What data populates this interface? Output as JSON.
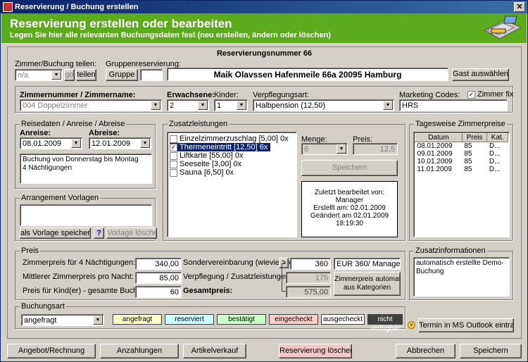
{
  "window": {
    "title": "Reservierung / Buchung erstellen",
    "close": "✕"
  },
  "header": {
    "title": "Reservierung erstellen oder bearbeiten",
    "subtitle": "Legen Sie hier alle relevanten Buchungsdaten fest (neu erstellen, ändern oder löschen)"
  },
  "reservation": {
    "number_label": "Reservierungsnummer 66"
  },
  "share": {
    "label": "Zimmer/Buchung teilen:",
    "value": "n/a",
    "go": "go",
    "teilen": "teilen"
  },
  "group": {
    "label": "Gruppenreservierung:",
    "button": "Gruppe",
    "value": ""
  },
  "guest": {
    "text": "Maik Olavssen  Hafenmeile 66a 20095 Hamburg",
    "select_button": "Gast auswählen"
  },
  "room": {
    "label": "Zimmernummer / Zimmername:",
    "value": "004 Doppelzimmer"
  },
  "adults": {
    "label": "Erwachsene:",
    "value": "2"
  },
  "kids": {
    "label": "Kinder:",
    "value": "1"
  },
  "meal": {
    "label": "Verpflegungsart:",
    "value": "Halbpension (12,50)"
  },
  "marketing": {
    "label": "Marketing Codes:",
    "fix_label": "Zimmer fix",
    "value": "HRS"
  },
  "travel": {
    "title": "Reisedaten / Anreise / Abreise",
    "arrival_label": "Anreise:",
    "arrival": "08.01.2009",
    "departure_label": "Abreise:",
    "departure": "12.01.2009",
    "info_line1": "Buchung von Donnerstag bis Montag",
    "info_line2": "4 Nächtigungen"
  },
  "arrangement": {
    "title": "Arrangement Vorlagen",
    "save": "als Vorlage speichern",
    "help": "?",
    "delete": "Vorlage löschen"
  },
  "extras": {
    "title": "Zusatzleistungen",
    "items": [
      {
        "label": "Einzelzimmerzuschlag  [5,00] 0x",
        "checked": false,
        "selected": false
      },
      {
        "label": "Thermeneintritt  [12,50] 6x",
        "checked": true,
        "selected": true
      },
      {
        "label": "Liftkarte  [55,00] 0x",
        "checked": false,
        "selected": false
      },
      {
        "label": "Seeseite  [3,00] 0x",
        "checked": false,
        "selected": false
      },
      {
        "label": "Sauna  [6,50] 0x",
        "checked": false,
        "selected": false
      }
    ],
    "qty_label": "Menge:",
    "qty": "6",
    "price_label": "Preis:",
    "price": "12,5",
    "save": "Speichern",
    "edit_info": [
      "Zuletzt bearbeitet von:",
      "Manager",
      "Erstellt am: 02.01.2009",
      "Geändert am 02.01.2009 18:19:30"
    ]
  },
  "daily": {
    "title": "Tagesweise Zimmerpreise",
    "columns": [
      "Datum",
      "Preis",
      "Kat."
    ],
    "rows": [
      [
        "08.01.2009",
        "85",
        "D..."
      ],
      [
        "09.01.2009",
        "85",
        "D..."
      ],
      [
        "10.01.2009",
        "85",
        "D..."
      ],
      [
        "11.01.2009",
        "85",
        "D..."
      ]
    ]
  },
  "price": {
    "title": "Preis",
    "room_label": "Zimmerpreis für 4 Nächtigungen:",
    "room": "340,00",
    "avg_label": "Mittlerer Zimmerpreis pro Nacht:",
    "avg": "85,00",
    "kids_label": "Preis für Kind(er) - gesamte Buchung:",
    "kids": "60",
    "special_label": "Sondervereinbarung (wieviel/wer):",
    "special_btn": ">",
    "special": "360",
    "special_who": "EUR 360/ Manager",
    "extras_label": "Verpflegung / Zusatzleistungen:",
    "extras": "175",
    "total_label": "Gesamtpreis:",
    "total": "575,00",
    "auto_btn_line1": "Zimmerpreis automatisch",
    "auto_btn_line2": "aus Kategorien"
  },
  "info": {
    "title": "Zusatzinformationen",
    "text": "automatisch erstellte Demo-Buchung"
  },
  "booking_type": {
    "title": "Buchungsart",
    "value": "angefragt",
    "tags": [
      {
        "label": "angefragt",
        "color": "#ffffcc"
      },
      {
        "label": "reserviert",
        "color": "#ccffff"
      },
      {
        "label": "bestätigt",
        "color": "#ccffcc"
      },
      {
        "label": "eingecheckt",
        "color": "#ffcccc"
      },
      {
        "label": "ausgecheckt",
        "color": "#ffffff"
      },
      {
        "label": "nicht verfügbar",
        "color": "#404040"
      }
    ]
  },
  "outlook": {
    "label": "Termin in MS Outlook eintragen"
  },
  "footer": {
    "offer": "Angebot/Rechnung",
    "payments": "Anzahlungen",
    "items": "Artikelverkauf",
    "delete": "Reservierung löschen",
    "cancel": "Abbrechen",
    "save": "Speichern"
  }
}
